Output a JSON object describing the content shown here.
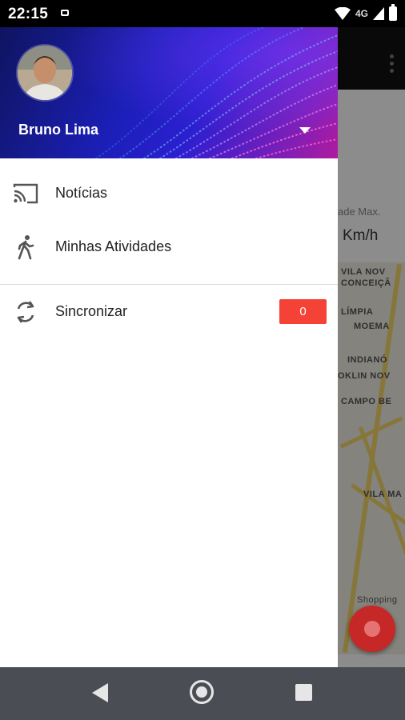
{
  "status_bar": {
    "time": "22:15",
    "network_label": "4G"
  },
  "background_app": {
    "speed_label": "ade Max.",
    "speed_unit": "Km/h",
    "map_labels": [
      "VILA NOV",
      "CONCEIÇÃ",
      "LÍMPIA",
      "MOEMA",
      "INDIANÓ",
      "OKLIN NOV",
      "CAMPO BE",
      "VILA MA",
      "Shopping"
    ]
  },
  "drawer": {
    "user_name": "Bruno Lima",
    "items": [
      {
        "label": "Notícias",
        "icon": "cast-icon"
      },
      {
        "label": "Minhas Atividades",
        "icon": "walking-person-icon"
      },
      {
        "label": "Sincronizar",
        "icon": "sync-icon",
        "badge": "0"
      }
    ]
  },
  "colors": {
    "badge": "#f44336",
    "fab": "#c62828",
    "nav_bar": "#4a4e54"
  }
}
